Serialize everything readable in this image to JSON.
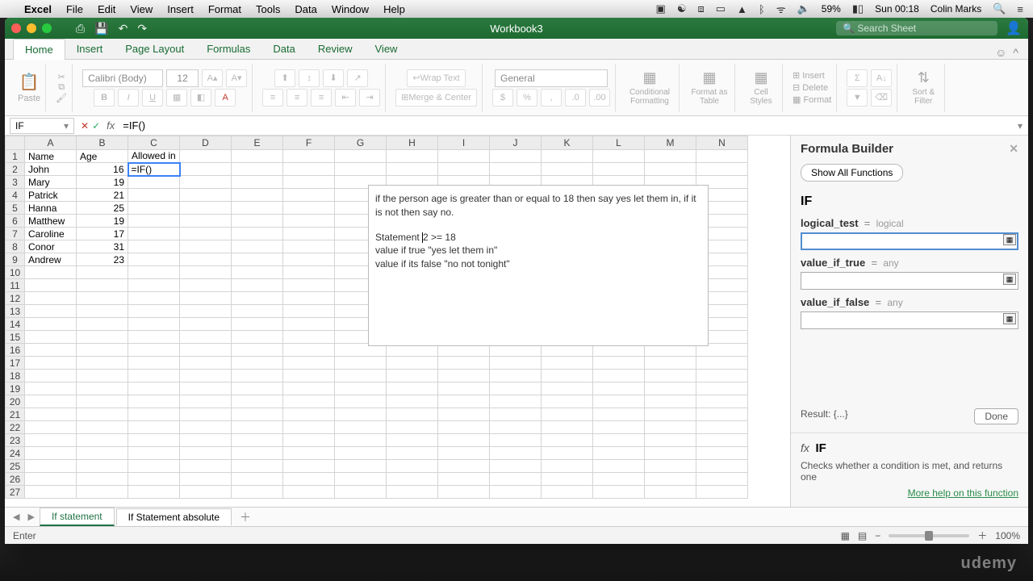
{
  "menubar": {
    "app": "Excel",
    "items": [
      "File",
      "Edit",
      "View",
      "Insert",
      "Format",
      "Tools",
      "Data",
      "Window",
      "Help"
    ],
    "battery": "59%",
    "clock": "Sun 00:18",
    "user": "Colin Marks"
  },
  "window": {
    "title": "Workbook3",
    "search_placeholder": "Search Sheet"
  },
  "ribbon": {
    "tabs": [
      "Home",
      "Insert",
      "Page Layout",
      "Formulas",
      "Data",
      "Review",
      "View"
    ],
    "active_tab": "Home",
    "paste": "Paste",
    "font_name": "Calibri (Body)",
    "font_size": "12",
    "wrap": "Wrap Text",
    "merge": "Merge & Center",
    "number_format": "General",
    "cond": "Conditional Formatting",
    "ftable": "Format as Table",
    "cstyles": "Cell Styles",
    "insert": "Insert",
    "delete": "Delete",
    "format": "Format",
    "sort": "Sort & Filter"
  },
  "formula": {
    "name_box": "IF",
    "bar": "=IF()"
  },
  "columns": [
    "A",
    "B",
    "C",
    "D",
    "E",
    "F",
    "G",
    "H",
    "I",
    "J",
    "K",
    "L",
    "M",
    "N"
  ],
  "headers": [
    "Name",
    "Age",
    "Allowed in"
  ],
  "rows": [
    {
      "name": "John",
      "age": 16,
      "allowed": "=IF()"
    },
    {
      "name": "Mary",
      "age": 19,
      "allowed": ""
    },
    {
      "name": "Patrick",
      "age": 21,
      "allowed": ""
    },
    {
      "name": "Hanna",
      "age": 25,
      "allowed": ""
    },
    {
      "name": "Matthew",
      "age": 19,
      "allowed": ""
    },
    {
      "name": "Caroline",
      "age": 17,
      "allowed": ""
    },
    {
      "name": "Conor",
      "age": 31,
      "allowed": ""
    },
    {
      "name": "Andrew",
      "age": 23,
      "allowed": ""
    }
  ],
  "note": {
    "para": "if the person age is greater than or equal to 18 then say yes let them in, if it is not then say no.",
    "l1a": "Statement  ",
    "l1b": "2 >= 18",
    "l2": "value if true \"yes let them in\"",
    "l3": "value if its false \"no not tonight\""
  },
  "panel": {
    "title": "Formula Builder",
    "show_all": "Show All Functions",
    "fx": "IF",
    "args": [
      {
        "label": "logical_test",
        "hint": "logical",
        "active": true
      },
      {
        "label": "value_if_true",
        "hint": "any",
        "active": false
      },
      {
        "label": "value_if_false",
        "hint": "any",
        "active": false
      }
    ],
    "result_label": "Result:",
    "result_value": "{...}",
    "done": "Done",
    "help_name": "IF",
    "help_desc": "Checks whether a condition is met, and returns one",
    "help_link": "More help on this function"
  },
  "sheet_tabs": {
    "tabs": [
      "If statement",
      "If Statement absolute"
    ],
    "active": 0
  },
  "status": {
    "mode": "Enter",
    "zoom": "100%"
  },
  "watermark": "udemy"
}
